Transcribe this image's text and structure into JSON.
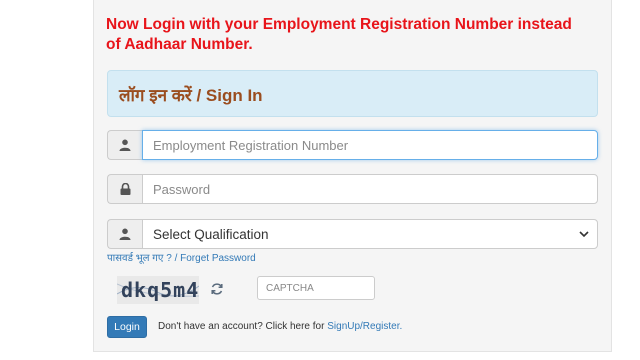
{
  "notice": "Now Login with your Employment Registration Number instead of Aadhaar Number.",
  "signin": {
    "title": "लॉग इन करें / Sign In"
  },
  "fields": {
    "registration_placeholder": "Employment Registration Number",
    "password_placeholder": "Password",
    "qualification_selected": "Select Qualification"
  },
  "forgot_password": "पासवर्ड भूल गए ? / Forget Password",
  "captcha": {
    "image_text": "dkq5m4",
    "placeholder": "CAPTCHA"
  },
  "login_label": "Login",
  "account": {
    "prompt": "Don't have an account? Click here for ",
    "link": "SignUp/Register."
  },
  "icons": {
    "registration": "user-icon",
    "password": "lock-icon",
    "qualification": "user-icon",
    "refresh": "refresh-icon",
    "dropdown": "chevron-down-icon"
  },
  "colors": {
    "notice": "#e8141a",
    "signin_bg": "#d9edf7",
    "signin_title": "#9a4d1f",
    "primary": "#337ab7",
    "focus_border": "#66afe9"
  }
}
